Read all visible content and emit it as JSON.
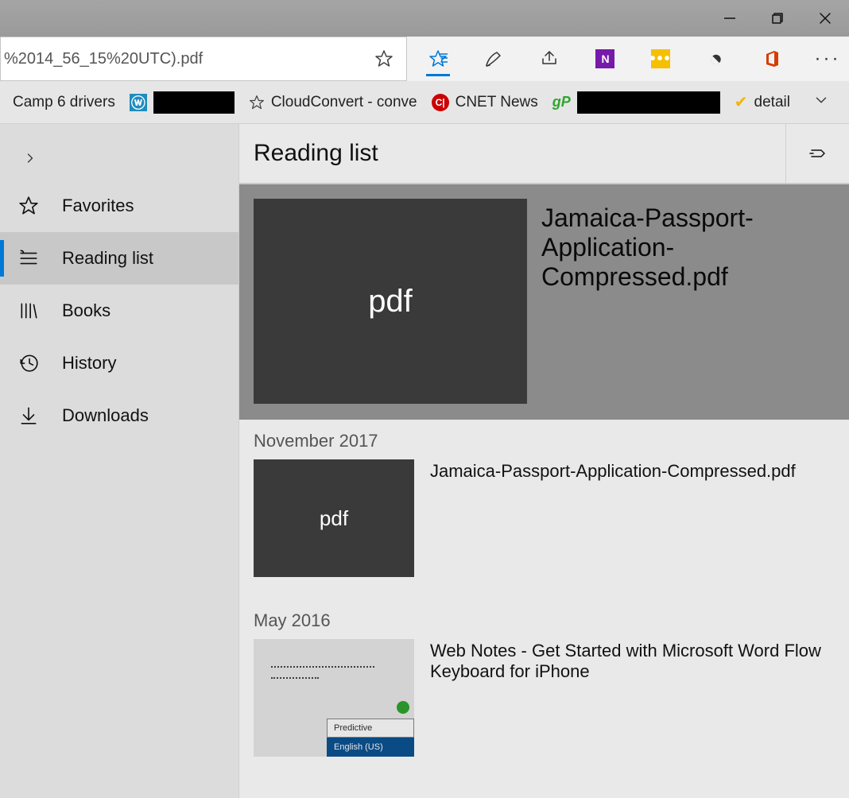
{
  "window": {
    "min_tooltip": "Minimize",
    "max_tooltip": "Restore",
    "close_tooltip": "Close"
  },
  "urlbar": {
    "text": "%2014_56_15%20UTC).pdf"
  },
  "toolbar": {
    "readinglist": "Reading list",
    "notes": "Make a web note",
    "share": "Share",
    "onenote": "N",
    "lastpass": "•••",
    "ublock": "uBlock",
    "office": "Office",
    "more": "More"
  },
  "bookmarks": {
    "items": [
      {
        "label": "Camp 6 drivers",
        "icon": "star"
      },
      {
        "label": "",
        "icon": "wp"
      },
      {
        "label": "CloudConvert - conve",
        "icon": "star"
      },
      {
        "label": "CNET News",
        "icon": "cnet"
      },
      {
        "label": "",
        "icon": "gp"
      },
      {
        "label": "detail",
        "icon": "norton"
      }
    ]
  },
  "hub": {
    "panel_title": "Reading list",
    "nav": [
      {
        "label": "Favorites"
      },
      {
        "label": "Reading list"
      },
      {
        "label": "Books"
      },
      {
        "label": "History"
      },
      {
        "label": "Downloads"
      }
    ],
    "featured": {
      "thumb_text": "pdf",
      "title": "Jamaica-Passport-Application-Compressed.pdf"
    },
    "groups": [
      {
        "date": "November 2017",
        "items": [
          {
            "thumb_text": "pdf",
            "title": "Jamaica-Passport-Application-Compressed.pdf",
            "thumb_kind": "pdf"
          }
        ]
      },
      {
        "date": "May 2016",
        "items": [
          {
            "thumb_text": "",
            "title": "Web Notes - Get Started with Microsoft Word Flow Keyboard for iPhone",
            "thumb_kind": "webnote",
            "thumb_seg1": "Predictive",
            "thumb_seg2": "English (US)"
          }
        ]
      }
    ]
  }
}
